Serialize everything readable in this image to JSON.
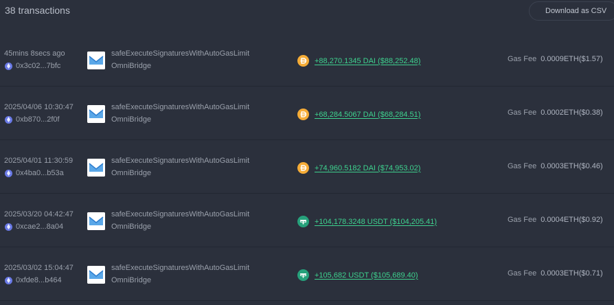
{
  "header": {
    "count": "38 transactions",
    "csv_label": "Download as CSV"
  },
  "colors": {
    "background": "#2b303c",
    "amount": "#3ed38f",
    "dai": "#f5ac37",
    "usdt": "#26a17b",
    "eth": "#6a7ae6"
  },
  "transactions": [
    {
      "time": "45mins 8secs ago",
      "hash": "0x3c02...7bfc",
      "method": "safeExecuteSignaturesWithAutoGasLimit",
      "contract": "OmniBridge",
      "token": "DAI",
      "token_icon": "dai-icon",
      "amount": "+88,270.1345 DAI ($88,252.48)",
      "fee_label": "Gas Fee",
      "fee": "0.0009ETH($1.57)"
    },
    {
      "time": "2025/04/06 10:30:47",
      "hash": "0xb870...2f0f",
      "method": "safeExecuteSignaturesWithAutoGasLimit",
      "contract": "OmniBridge",
      "token": "DAI",
      "token_icon": "dai-icon",
      "amount": "+68,284.5067 DAI ($68,284.51)",
      "fee_label": "Gas Fee",
      "fee": "0.0002ETH($0.38)"
    },
    {
      "time": "2025/04/01 11:30:59",
      "hash": "0x4ba0...b53a",
      "method": "safeExecuteSignaturesWithAutoGasLimit",
      "contract": "OmniBridge",
      "token": "DAI",
      "token_icon": "dai-icon",
      "amount": "+74,960.5182 DAI ($74,953.02)",
      "fee_label": "Gas Fee",
      "fee": "0.0003ETH($0.46)"
    },
    {
      "time": "2025/03/20 04:42:47",
      "hash": "0xcae2...8a04",
      "method": "safeExecuteSignaturesWithAutoGasLimit",
      "contract": "OmniBridge",
      "token": "USDT",
      "token_icon": "usdt-icon",
      "amount": "+104,178.3248 USDT ($104,205.41)",
      "fee_label": "Gas Fee",
      "fee": "0.0004ETH($0.92)"
    },
    {
      "time": "2025/03/02 15:04:47",
      "hash": "0xfde8...b464",
      "method": "safeExecuteSignaturesWithAutoGasLimit",
      "contract": "OmniBridge",
      "token": "USDT",
      "token_icon": "usdt-icon",
      "amount": "+105,682 USDT ($105,689.40)",
      "fee_label": "Gas Fee",
      "fee": "0.0003ETH($0.71)"
    }
  ]
}
